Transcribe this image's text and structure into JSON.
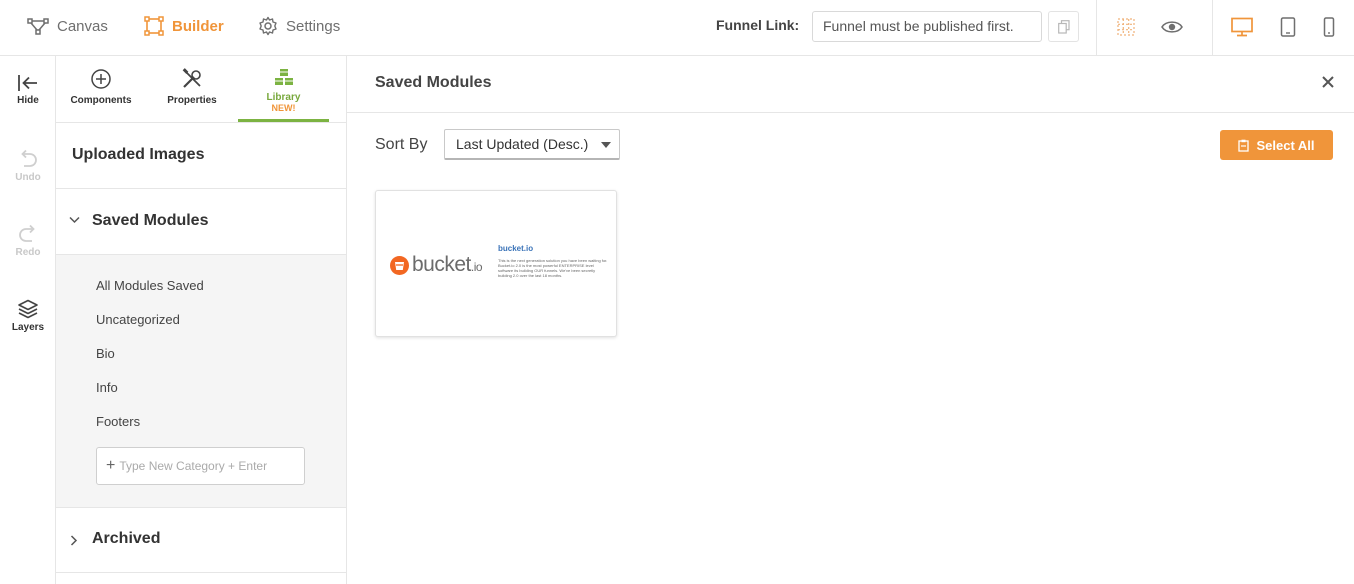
{
  "topbar": {
    "nav": [
      {
        "label": "Canvas",
        "icon": "vector-nodes-icon"
      },
      {
        "label": "Builder",
        "icon": "builder-frame-icon",
        "active": true
      },
      {
        "label": "Settings",
        "icon": "gear-icon"
      }
    ],
    "funnel_label": "Funnel Link:",
    "funnel_value": "Funnel must be published first.",
    "icons": [
      "copy-icon",
      "grid-icon",
      "eye-icon",
      "desktop-icon",
      "tablet-icon",
      "mobile-icon"
    ],
    "accent": "#f0953a"
  },
  "rail": {
    "hide": "Hide",
    "undo": "Undo",
    "redo": "Redo",
    "layers": "Layers"
  },
  "panel": {
    "tabs": {
      "components": "Components",
      "properties": "Properties",
      "library": "Library",
      "library_badge": "NEW!"
    },
    "uploaded_images": "Uploaded Images",
    "saved_modules": "Saved Modules",
    "categories": [
      "All Modules Saved",
      "Uncategorized",
      "Bio",
      "Info",
      "Footers"
    ],
    "category_placeholder": "Type New Category + Enter",
    "archived": "Archived"
  },
  "main": {
    "title": "Saved Modules",
    "sort_label": "Sort By",
    "sort_value": "Last Updated (Desc.)",
    "select_all": "Select All",
    "module_card": {
      "logo_text": "bucket",
      "logo_suffix": ".io",
      "heading": "bucket.io",
      "body": "This is the next generation solution you have been waiting for. Bucket.io 2.0 is the most powerful ENTERPRISE level software its building OUR funnels. We've been secretly building 2.0 over the last 18 months."
    }
  }
}
